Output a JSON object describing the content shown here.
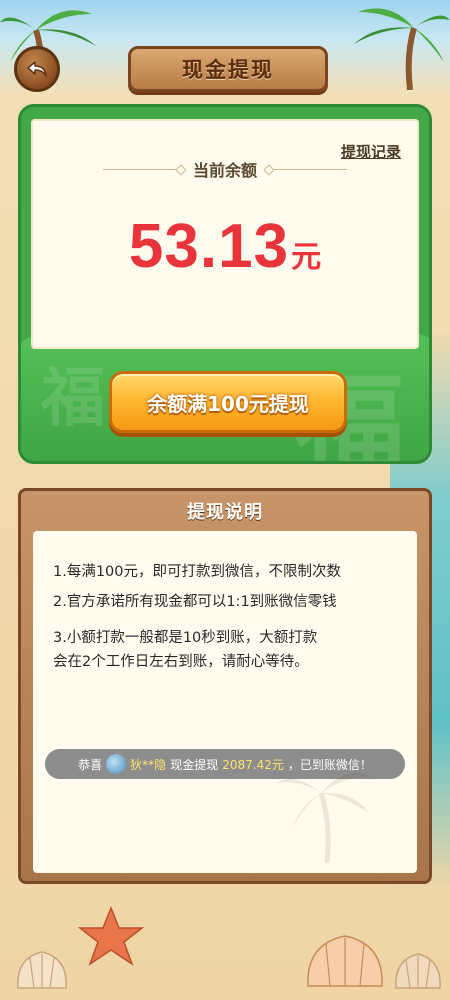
{
  "header": {
    "title": "现金提现",
    "back_icon": "back-arrow-icon"
  },
  "balance": {
    "label": "当前余额",
    "history_link": "提现记录",
    "amount": "53.13",
    "unit": "元",
    "withdraw_button": "余额满100元提现"
  },
  "instructions": {
    "title": "提现说明",
    "rules": [
      "1.每满100元，即可打款到微信，不限制次数",
      "2.官方承诺所有现金都可以1:1到账微信零钱",
      "3.小额打款一般都是10秒到账，大额打款",
      "会在2个工作日左右到账，请耐心等待。"
    ],
    "ticker": {
      "prefix": "恭喜",
      "user": "狄**隐",
      "middle": "现金提现",
      "amount": "2087.42元",
      "suffix": "，已到账微信！"
    }
  },
  "colors": {
    "accent_red": "#e8343a",
    "card_green": "#43a948",
    "button_orange": "#ffb52e",
    "wood": "#b97c45"
  }
}
